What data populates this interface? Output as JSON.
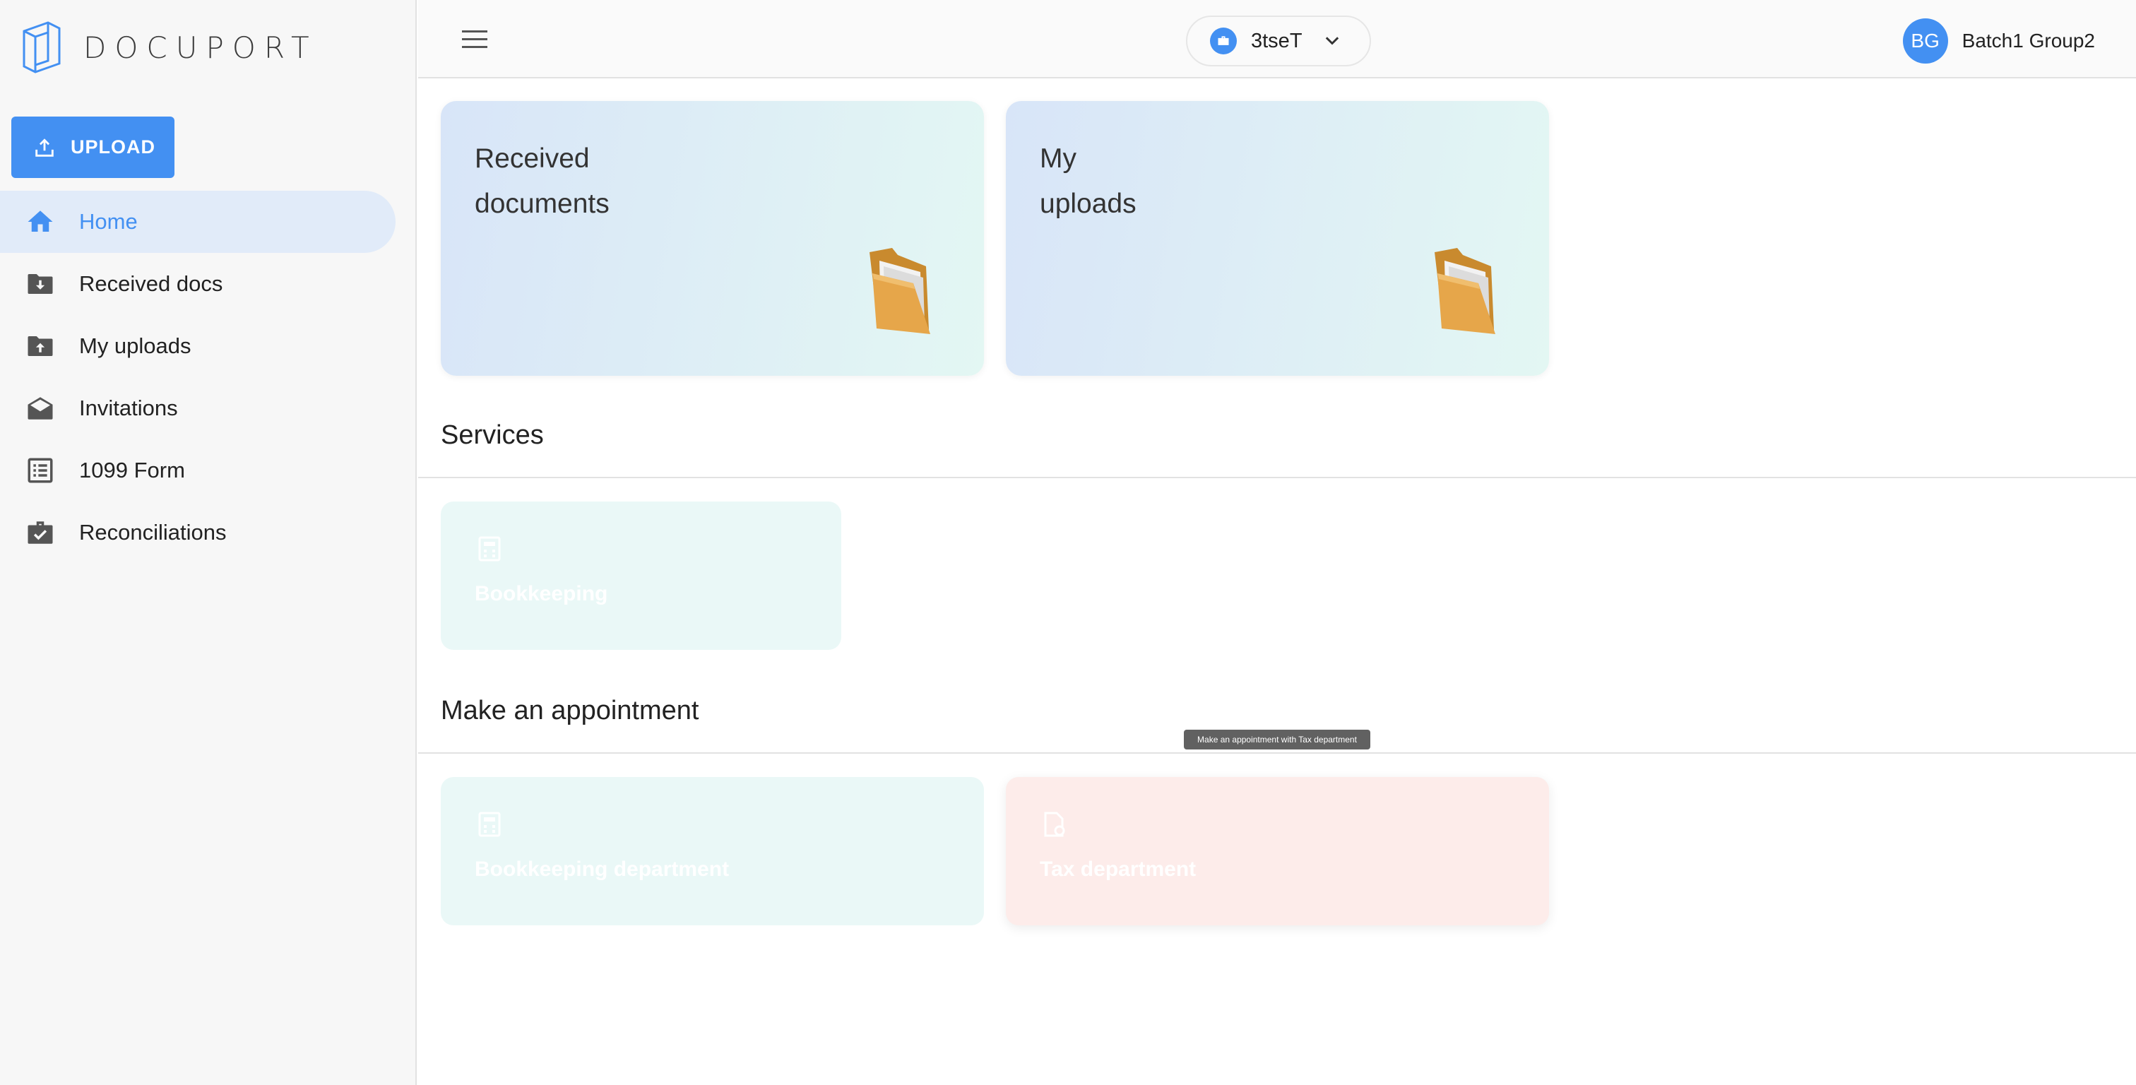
{
  "sidebar": {
    "logo_text": "DOCUPORT",
    "upload_label": "UPLOAD",
    "items": [
      {
        "label": "Home",
        "icon": "home-icon"
      },
      {
        "label": "Received docs",
        "icon": "folder-download-icon"
      },
      {
        "label": "My uploads",
        "icon": "folder-upload-icon"
      },
      {
        "label": "Invitations",
        "icon": "envelope-open-icon"
      },
      {
        "label": "1099 Form",
        "icon": "list-form-icon"
      },
      {
        "label": "Reconciliations",
        "icon": "briefcase-check-icon"
      }
    ]
  },
  "header": {
    "company_name": "3tseT",
    "user_initials": "BG",
    "user_name": "Batch1 Group2"
  },
  "cards": {
    "received_line1": "Received",
    "received_line2": "documents",
    "uploads_line1": "My",
    "uploads_line2": "uploads"
  },
  "services": {
    "title": "Services",
    "bookkeeping": "Bookkeeping"
  },
  "appointment": {
    "title": "Make an appointment",
    "bookkeeping_department": "Bookkeeping department",
    "tax_department": "Tax department",
    "tooltip": "Make an appointment with Tax department"
  },
  "colors": {
    "accent": "#4390f2",
    "active_nav_bg": "#e1ebf9",
    "teal_card": "#eaf8f7",
    "pink_card": "#fdecea"
  }
}
